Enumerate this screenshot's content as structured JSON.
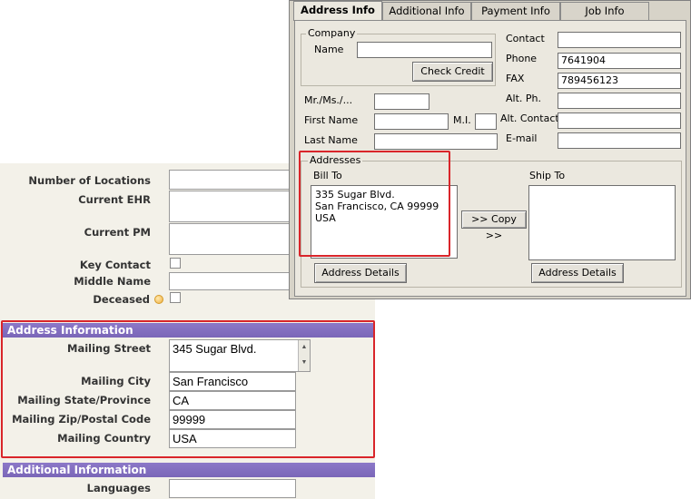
{
  "crm": {
    "fields_top": [
      {
        "label": "Number of Locations",
        "value": ""
      },
      {
        "label": "Current EHR",
        "value": ""
      },
      {
        "label": "Current PM",
        "value": ""
      },
      {
        "label": "Key Contact",
        "value": ""
      },
      {
        "label": "Middle Name",
        "value": ""
      },
      {
        "label": "Deceased",
        "value": ""
      }
    ],
    "address_section": {
      "title": "Address Information",
      "street_label": "Mailing Street",
      "street_value": "345 Sugar Blvd.",
      "city_label": "Mailing City",
      "city_value": "San Francisco",
      "state_label": "Mailing State/Province",
      "state_value": "CA",
      "zip_label": "Mailing Zip/Postal Code",
      "zip_value": "99999",
      "country_label": "Mailing Country",
      "country_value": "USA"
    },
    "additional_section": {
      "title": "Additional Information",
      "languages_label": "Languages",
      "languages_value": ""
    }
  },
  "dialog": {
    "tabs": [
      {
        "label": "Address Info",
        "active": true
      },
      {
        "label": "Additional Info",
        "active": false
      },
      {
        "label": "Payment Info",
        "active": false
      },
      {
        "label": "Job Info",
        "active": false
      }
    ],
    "company": {
      "group_title": "Company",
      "name_label": "Name",
      "name_value": "",
      "check_credit": "Check Credit"
    },
    "contact_label": "Contact",
    "contact_value": "",
    "phone_label": "Phone",
    "phone_value": "7641904",
    "fax_label": "FAX",
    "fax_value": "789456123",
    "alt_ph_label": "Alt. Ph.",
    "alt_ph_value": "",
    "alt_contact_label": "Alt. Contact",
    "alt_contact_value": "",
    "email_label": "E-mail",
    "email_value": "",
    "salutation_label": "Mr./Ms./...",
    "salutation_value": "",
    "first_name_label": "First Name",
    "first_name_value": "",
    "mi_label": "M.I.",
    "mi_value": "",
    "last_name_label": "Last Name",
    "last_name_value": "",
    "addresses": {
      "group_title": "Addresses",
      "bill_to_label": "Bill To",
      "bill_to_value": "335 Sugar Blvd.\nSan Francisco, CA 99999\nUSA",
      "copy_button": ">> Copy >>",
      "ship_to_label": "Ship To",
      "ship_to_value": "",
      "bill_details_button": "Address Details",
      "ship_details_button": "Address Details"
    }
  },
  "colors": {
    "section_header": "#7a66b8",
    "highlight_red": "#d9252a",
    "form_bg": "#f3f1e9",
    "dialog_bg": "#ebe8df"
  }
}
